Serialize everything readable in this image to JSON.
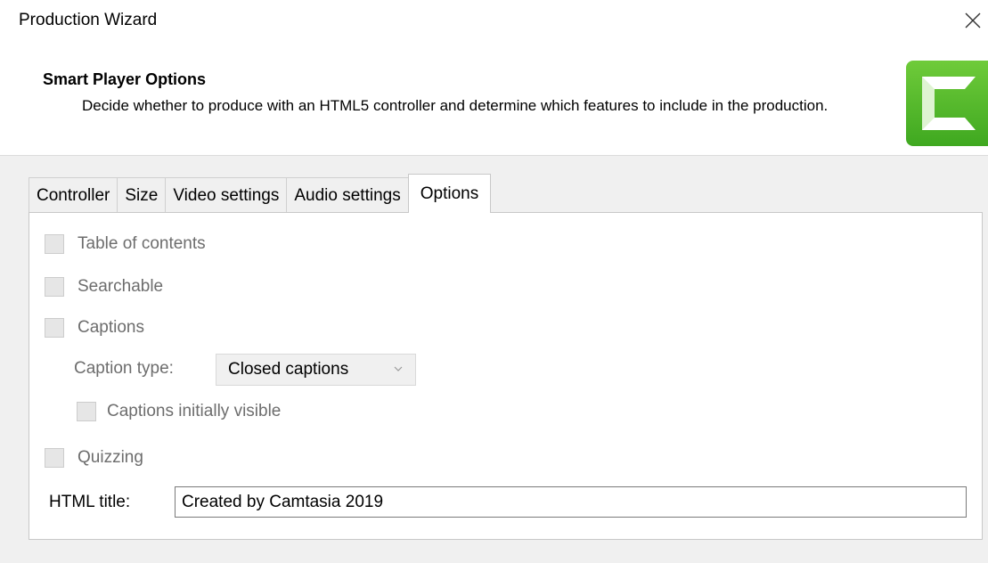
{
  "window": {
    "title": "Production Wizard"
  },
  "header": {
    "title": "Smart Player Options",
    "description": "Decide whether to produce with an HTML5 controller and determine which features to include in the production."
  },
  "tabs": [
    {
      "label": "Controller",
      "active": false
    },
    {
      "label": "Size",
      "active": false
    },
    {
      "label": "Video settings",
      "active": false
    },
    {
      "label": "Audio settings",
      "active": false
    },
    {
      "label": "Options",
      "active": true
    }
  ],
  "options": {
    "table_of_contents": {
      "label": "Table of contents",
      "checked": false,
      "enabled": false
    },
    "searchable": {
      "label": "Searchable",
      "checked": false,
      "enabled": false
    },
    "captions": {
      "label": "Captions",
      "checked": false,
      "enabled": false
    },
    "caption_type": {
      "label": "Caption type:",
      "value": "Closed captions",
      "enabled": false
    },
    "captions_initially_visible": {
      "label": "Captions initially visible",
      "checked": false,
      "enabled": false
    },
    "quizzing": {
      "label": "Quizzing",
      "checked": false,
      "enabled": false
    },
    "html_title": {
      "label": "HTML title:",
      "value": "Created by Camtasia 2019"
    }
  },
  "colors": {
    "logo_green": "#4cb82a",
    "disabled_text": "#6d6d6d",
    "body_background": "#f0f0f0"
  },
  "icons": {
    "close": "close-icon",
    "logo": "camtasia-logo-icon",
    "dropdown": "chevron-down-icon"
  }
}
